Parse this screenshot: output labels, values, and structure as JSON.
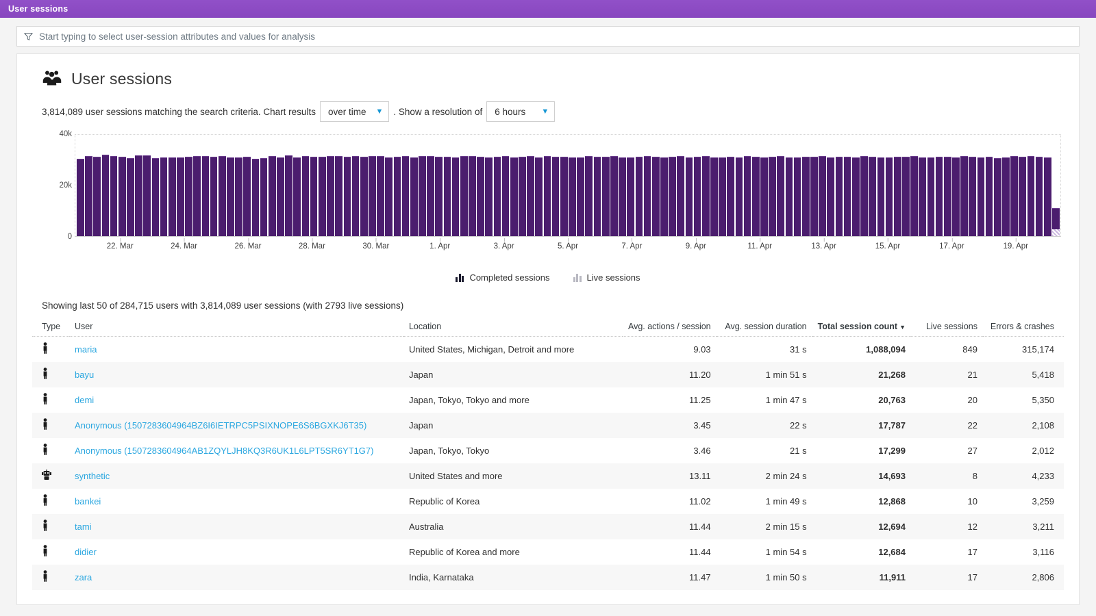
{
  "window": {
    "title": "User sessions"
  },
  "search": {
    "placeholder": "Start typing to select user-session attributes and values for analysis",
    "icon": "funnel-icon"
  },
  "header": {
    "title": "User sessions",
    "icon": "user-group-icon"
  },
  "controls": {
    "prefix": "3,814,089 user sessions matching the search criteria. Chart results",
    "chart_mode": "over time",
    "middle": ". Show a resolution of",
    "resolution": "6 hours"
  },
  "chart_data": {
    "type": "bar",
    "title": "",
    "xlabel": "",
    "ylabel": "",
    "ylim": [
      0,
      40000
    ],
    "ytick_labels": [
      "40k",
      "20k",
      "0"
    ],
    "yticks": [
      40000,
      20000,
      0
    ],
    "grid": false,
    "legend_position": "bottom",
    "legend": [
      "Completed sessions",
      "Live sessions"
    ],
    "series": [
      {
        "name": "Completed sessions",
        "color": "#4b1d6e",
        "values": [
          30600,
          31600,
          31300,
          32300,
          31700,
          31300,
          30900,
          31800,
          31800,
          30900,
          31200,
          31000,
          31000,
          31400,
          31700,
          31500,
          31400,
          31600,
          31100,
          31000,
          31300,
          30600,
          30800,
          31600,
          31200,
          31800,
          31000,
          31700,
          31400,
          31300,
          31600,
          31500,
          31400,
          31700,
          31300,
          31500,
          31600,
          31000,
          31400,
          31600,
          31000,
          31500,
          31600,
          31300,
          31400,
          31200,
          31500,
          31700,
          31300,
          31100,
          31400,
          31500,
          31000,
          31300,
          31600,
          31100,
          31500,
          31300,
          31400,
          31000,
          31200,
          31500,
          31400,
          31300,
          31600,
          31000,
          31200,
          31400,
          31500,
          31300,
          31100,
          31400,
          31600,
          31200,
          31300,
          31500,
          31000,
          31200,
          31400,
          31100,
          31500,
          31300,
          31200,
          31400,
          31600,
          31000,
          31200,
          31300,
          31400,
          31500,
          31100,
          31300,
          31400,
          31200,
          31500,
          31300,
          31000,
          31200,
          31400,
          31300,
          31500,
          31200,
          31100,
          31400,
          31300,
          31000,
          31600,
          31400,
          31200,
          31300,
          30900,
          31200,
          31500,
          31300,
          31700,
          31400,
          31100,
          11200
        ],
        "live_values": [
          0,
          0,
          0,
          0,
          0,
          0,
          0,
          0,
          0,
          0,
          0,
          0,
          0,
          0,
          0,
          0,
          0,
          0,
          0,
          0,
          0,
          0,
          0,
          0,
          0,
          0,
          0,
          0,
          0,
          0,
          0,
          0,
          0,
          0,
          0,
          0,
          0,
          0,
          0,
          0,
          0,
          0,
          0,
          0,
          0,
          0,
          0,
          0,
          0,
          0,
          0,
          0,
          0,
          0,
          0,
          0,
          0,
          0,
          0,
          0,
          0,
          0,
          0,
          0,
          0,
          0,
          0,
          0,
          0,
          0,
          0,
          0,
          0,
          0,
          0,
          0,
          0,
          0,
          0,
          0,
          0,
          0,
          0,
          0,
          0,
          0,
          0,
          0,
          0,
          0,
          0,
          0,
          0,
          0,
          0,
          0,
          0,
          0,
          0,
          0,
          0,
          0,
          0,
          0,
          0,
          0,
          0,
          0,
          0,
          0,
          0,
          0,
          0,
          0,
          0,
          0,
          0,
          2793
        ]
      }
    ],
    "xtick_labels": [
      "22. Mar",
      "24. Mar",
      "26. Mar",
      "28. Mar",
      "30. Mar",
      "1. Apr",
      "3. Apr",
      "5. Apr",
      "7. Apr",
      "9. Apr",
      "11. Apr",
      "13. Apr",
      "15. Apr",
      "17. Apr",
      "19. Apr"
    ]
  },
  "table": {
    "summary": "Showing last 50 of 284,715 users with 3,814,089 user sessions (with 2793 live sessions)",
    "headers": {
      "type": "Type",
      "user": "User",
      "location": "Location",
      "actions": "Avg. actions / session",
      "duration": "Avg. session duration",
      "total": "Total session count",
      "live": "Live sessions",
      "errors": "Errors & crashes"
    },
    "sorted_column": "total",
    "sort_arrow": "▼",
    "rows": [
      {
        "type_icon": "person-icon",
        "user": "maria",
        "location": "United States, Michigan, Detroit and more",
        "actions": "9.03",
        "duration": "31 s",
        "total": "1,088,094",
        "live": "849",
        "errors": "315,174"
      },
      {
        "type_icon": "person-icon",
        "user": "bayu",
        "location": "Japan",
        "actions": "11.20",
        "duration": "1 min 51 s",
        "total": "21,268",
        "live": "21",
        "errors": "5,418"
      },
      {
        "type_icon": "person-icon",
        "user": "demi",
        "location": "Japan, Tokyo, Tokyo and more",
        "actions": "11.25",
        "duration": "1 min 47 s",
        "total": "20,763",
        "live": "20",
        "errors": "5,350"
      },
      {
        "type_icon": "person-icon",
        "user": "Anonymous (1507283604964BZ6I6IETRPC5PSIXNOPE6S6BGXKJ6T35)",
        "location": "Japan",
        "actions": "3.45",
        "duration": "22 s",
        "total": "17,787",
        "live": "22",
        "errors": "2,108"
      },
      {
        "type_icon": "person-icon",
        "user": "Anonymous (1507283604964AB1ZQYLJH8KQ3R6UK1L6LPT5SR6YT1G7)",
        "location": "Japan, Tokyo, Tokyo",
        "actions": "3.46",
        "duration": "21 s",
        "total": "17,299",
        "live": "27",
        "errors": "2,012"
      },
      {
        "type_icon": "robot-icon",
        "user": "synthetic",
        "location": "United States and more",
        "actions": "13.11",
        "duration": "2 min 24 s",
        "total": "14,693",
        "live": "8",
        "errors": "4,233"
      },
      {
        "type_icon": "person-icon",
        "user": "bankei",
        "location": "Republic of Korea",
        "actions": "11.02",
        "duration": "1 min 49 s",
        "total": "12,868",
        "live": "10",
        "errors": "3,259"
      },
      {
        "type_icon": "person-icon",
        "user": "tami",
        "location": "Australia",
        "actions": "11.44",
        "duration": "2 min 15 s",
        "total": "12,694",
        "live": "12",
        "errors": "3,211"
      },
      {
        "type_icon": "person-icon",
        "user": "didier",
        "location": "Republic of Korea and more",
        "actions": "11.44",
        "duration": "1 min 54 s",
        "total": "12,684",
        "live": "17",
        "errors": "3,116"
      },
      {
        "type_icon": "person-icon",
        "user": "zara",
        "location": "India, Karnataka",
        "actions": "11.47",
        "duration": "1 min 50 s",
        "total": "11,911",
        "live": "17",
        "errors": "2,806"
      }
    ]
  },
  "colors": {
    "accent": "#8e44c8",
    "bar": "#4b1d6e",
    "live_bar": "#c8b3dd",
    "link": "#2ba7e0"
  }
}
